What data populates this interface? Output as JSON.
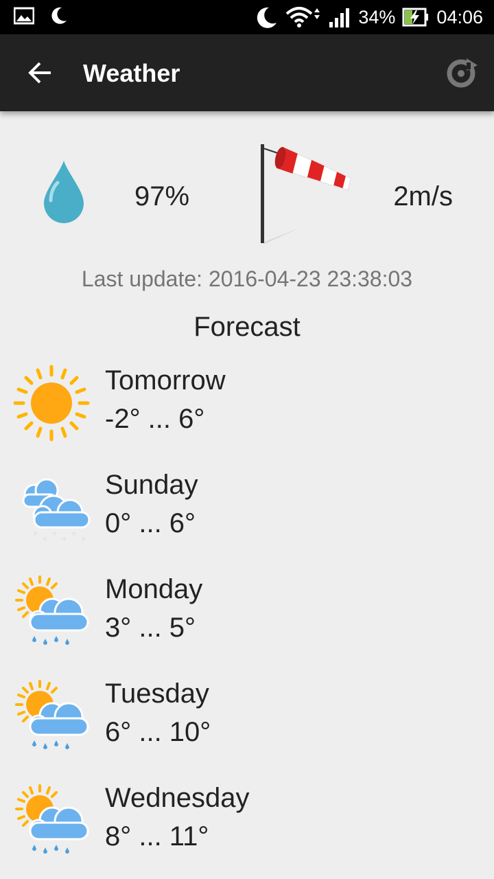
{
  "status_bar": {
    "battery": "34%",
    "time": "04:06"
  },
  "app_bar": {
    "title": "Weather"
  },
  "current": {
    "humidity": "97%",
    "wind_speed": "2m/s"
  },
  "last_update": "Last update: 2016-04-23 23:38:03",
  "forecast_title": "Forecast",
  "forecast": [
    {
      "day": "Tomorrow",
      "temp": "-2° ... 6°",
      "icon": "sun-icon"
    },
    {
      "day": "Sunday",
      "temp": "0° ... 6°",
      "icon": "snow-cloud-icon"
    },
    {
      "day": "Monday",
      "temp": "3° ... 5°",
      "icon": "sun-cloud-rain-icon"
    },
    {
      "day": "Tuesday",
      "temp": "6° ... 10°",
      "icon": "sun-cloud-rain-icon"
    },
    {
      "day": "Wednesday",
      "temp": "8° ... 11°",
      "icon": "sun-cloud-rain-icon"
    }
  ],
  "colors": {
    "status_bar": "#000000",
    "app_bar": "#222222",
    "background": "#eeeeee",
    "drop": "#4aaec8",
    "sun": "#ffa814",
    "cloud": "#6cb2ee"
  }
}
